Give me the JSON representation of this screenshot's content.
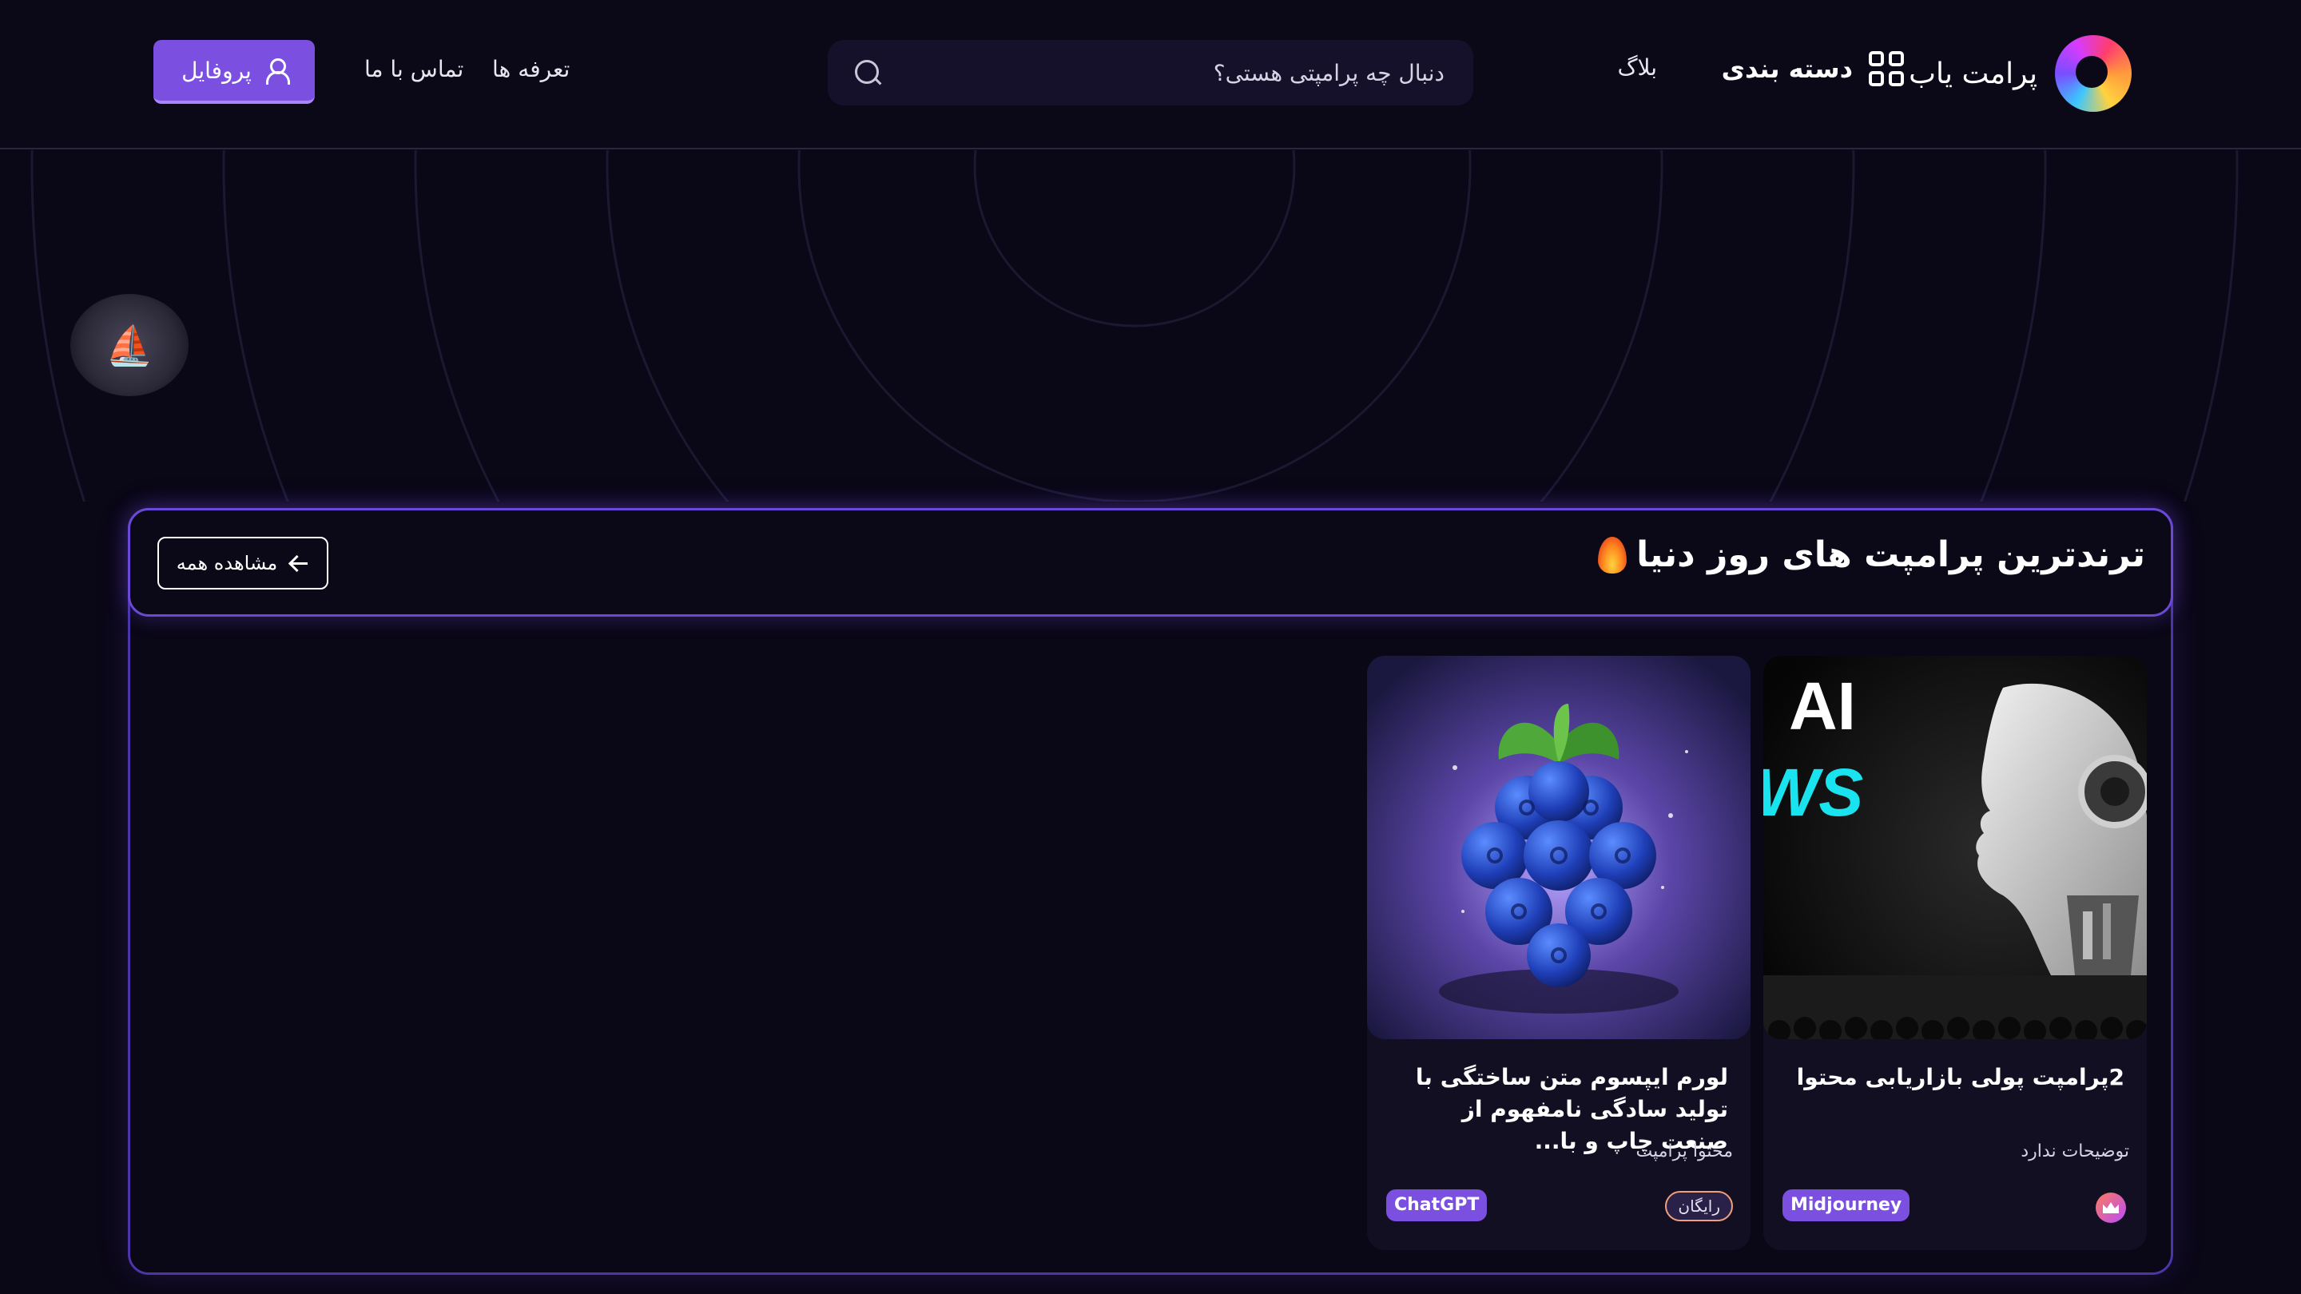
{
  "header": {
    "brand_name": "پرامت یاب",
    "categories_label": "دسته بندی",
    "blog_label": "بلاگ",
    "search_placeholder": "دنبال چه پرامپتی هستی؟",
    "pricing_label": "تعرفه ها",
    "contact_label": "تماس با ما",
    "profile_label": "پروفایل"
  },
  "trending": {
    "title": "ترندترین پرامپت های روز دنیا",
    "view_all_label": "مشاهده همه",
    "cards": [
      {
        "image_text_line1": "AI",
        "image_text_line2": "WS",
        "title": "2پرامپت پولی بازاریابی محتوا",
        "description": "توضیحات ندارد",
        "model": "Midjourney",
        "tier_icon": "crown-icon"
      },
      {
        "title": "لورم ایپسوم متن ساختگی با تولید سادگی نامفهوم از صنعت چاپ و با...",
        "description": "محتوا پرامپت",
        "model": "ChatGPT",
        "price_label": "رایگان"
      }
    ]
  },
  "colors": {
    "background": "#0a0716",
    "accent": "#7b4fe0",
    "section_border": "#6a49d6"
  }
}
